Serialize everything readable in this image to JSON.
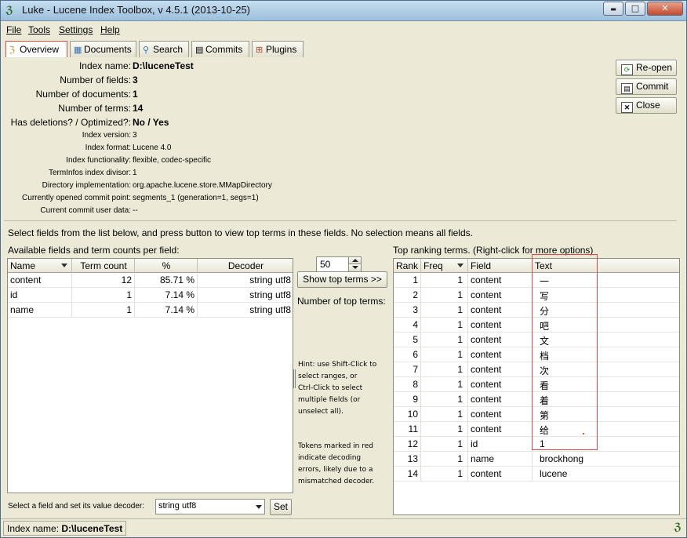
{
  "window": {
    "title": "Luke - Lucene Index Toolbox, v 4.5.1 (2013-10-25)",
    "minimize_label": "▬",
    "maximize_label": "□",
    "close_label": "✕"
  },
  "menu": [
    "File",
    "Tools",
    "Settings",
    "Help"
  ],
  "tabs": [
    {
      "label": "Overview",
      "icon": "overview-icon",
      "active": true
    },
    {
      "label": "Documents",
      "icon": "documents-icon"
    },
    {
      "label": "Search",
      "icon": "search-icon"
    },
    {
      "label": "Commits",
      "icon": "commits-icon"
    },
    {
      "label": "Plugins",
      "icon": "plugins-icon"
    }
  ],
  "overview": {
    "main_info": [
      {
        "label": "Index name:",
        "value": "D:\\luceneTest"
      },
      {
        "label": "Number of fields:",
        "value": "3"
      },
      {
        "label": "Number of documents:",
        "value": "1"
      },
      {
        "label": "Number of terms:",
        "value": "14"
      },
      {
        "label": "Has deletions? / Optimized?:",
        "value": "No / Yes"
      }
    ],
    "detail_info": [
      {
        "label": "Index version:",
        "value": "3"
      },
      {
        "label": "Index format:",
        "value": "Lucene 4.0"
      },
      {
        "label": "Index functionality:",
        "value": "flexible, codec-specific"
      },
      {
        "label": "TermInfos index divisor:",
        "value": "1"
      },
      {
        "label": "Directory implementation:",
        "value": "org.apache.lucene.store.MMapDirectory"
      },
      {
        "label": "Currently opened commit point:",
        "value": "segments_1 (generation=1, segs=1)"
      },
      {
        "label": "Current commit user data:",
        "value": "--"
      }
    ],
    "side_buttons": [
      {
        "label": "Re-open",
        "icon": "reopen-icon",
        "glyph": "⟳"
      },
      {
        "label": "Commit",
        "icon": "commit-icon",
        "glyph": "▤"
      },
      {
        "label": "Close",
        "icon": "close-icon",
        "glyph": "✕"
      }
    ],
    "instruction": "Select fields from the list below, and press button to view top terms in these fields. No selection means all fields.",
    "fields_caption": "Available fields and term counts per field:",
    "fields_table": {
      "headers": [
        "Name",
        "Term count",
        "%",
        "Decoder"
      ],
      "rows": [
        [
          "content",
          "12",
          "85.71 %",
          "string utf8"
        ],
        [
          "id",
          "1",
          "7.14 %",
          "string utf8"
        ],
        [
          "name",
          "1",
          "7.14 %",
          "string utf8"
        ]
      ]
    },
    "show_top_terms_label": "Show top terms >>",
    "num_top_terms_label": "Number of top terms:",
    "num_top_terms_value": "50",
    "hint_text": "Hint: use Shift-Click to\nselect ranges, or\nCtrl-Click to select\nmultiple fields (or\nunselect all).",
    "tokens_text": "Tokens marked in red\nindicate decoding\nerrors, likely due to a\nmismatched decoder.",
    "decoder_label": "Select a field and set its value decoder:",
    "decoder_value": "string utf8",
    "set_label": "Set",
    "top_terms_caption": "Top ranking terms. (Right-click for more options)",
    "terms_table": {
      "headers": [
        "Rank",
        "Freq",
        "Field",
        "Text"
      ],
      "rows": [
        [
          "1",
          "1",
          "content",
          "一"
        ],
        [
          "2",
          "1",
          "content",
          "写"
        ],
        [
          "3",
          "1",
          "content",
          "分"
        ],
        [
          "4",
          "1",
          "content",
          "吧"
        ],
        [
          "5",
          "1",
          "content",
          "文"
        ],
        [
          "6",
          "1",
          "content",
          "档"
        ],
        [
          "7",
          "1",
          "content",
          "次"
        ],
        [
          "8",
          "1",
          "content",
          "看"
        ],
        [
          "9",
          "1",
          "content",
          "着"
        ],
        [
          "10",
          "1",
          "content",
          "第"
        ],
        [
          "11",
          "1",
          "content",
          "给"
        ],
        [
          "12",
          "1",
          "id",
          "1"
        ],
        [
          "13",
          "1",
          "name",
          "brockhong"
        ],
        [
          "14",
          "1",
          "content",
          "lucene"
        ]
      ]
    }
  },
  "status": {
    "label": "Index name:",
    "value": "D:\\luceneTest"
  }
}
